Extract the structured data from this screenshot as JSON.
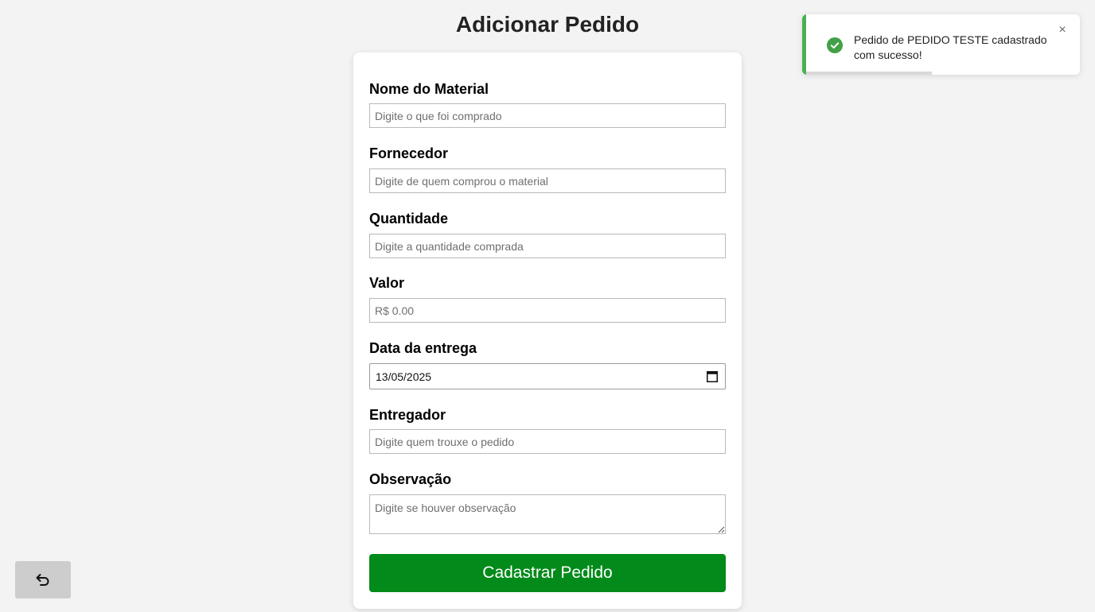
{
  "page": {
    "title": "Adicionar Pedido"
  },
  "form": {
    "fields": [
      {
        "label": "Nome do Material",
        "placeholder": "Digite o que foi comprado",
        "value": ""
      },
      {
        "label": "Fornecedor",
        "placeholder": "Digite de quem comprou o material",
        "value": ""
      },
      {
        "label": "Quantidade",
        "placeholder": "Digite a quantidade comprada",
        "value": ""
      },
      {
        "label": "Valor",
        "placeholder": "R$ 0.00",
        "value": ""
      },
      {
        "label": "Data da entrega",
        "value": "13/05/2025",
        "icon": "calendar-icon"
      },
      {
        "label": "Entregador",
        "placeholder": "Digite quem trouxe o pedido",
        "value": ""
      },
      {
        "label": "Observação",
        "placeholder": "Digite se houver observação",
        "value": ""
      }
    ],
    "submit_label": "Cadastrar Pedido"
  },
  "back_button": {
    "icon": "undo-arrow-icon"
  },
  "toast": {
    "message": "Pedido de PEDIDO TESTE cadastrado com sucesso!",
    "icon": "check-circle-icon",
    "close_icon": "close-icon",
    "progress_fraction": 0.46
  },
  "colors": {
    "background": "#f3f3f3",
    "submit_button": "#028a1a",
    "toast_success": "#4caf50",
    "back_button": "#cdcdcd"
  }
}
